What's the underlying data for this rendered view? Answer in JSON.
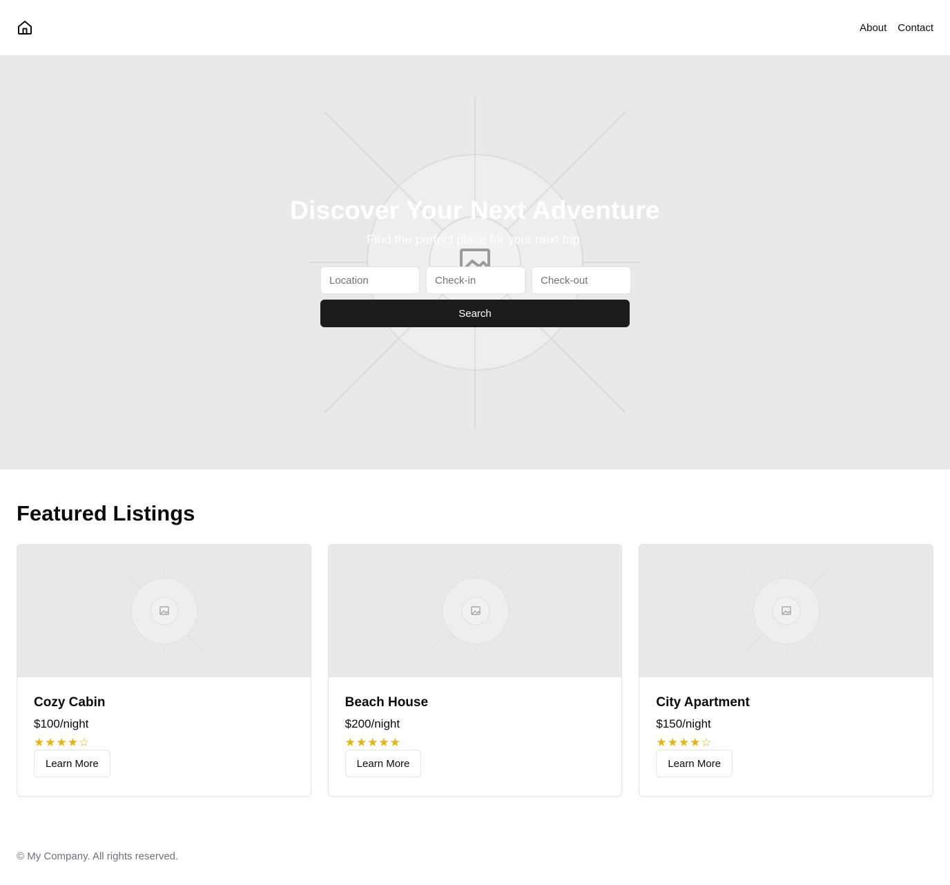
{
  "header": {
    "logo_icon": "home-icon",
    "nav": [
      "About",
      "Contact"
    ]
  },
  "hero": {
    "title": "Discover Your Next Adventure",
    "subtitle": "Find the perfect place for your next trip.",
    "background_icon": "image-placeholder-icon",
    "fields": {
      "location_placeholder": "Location",
      "checkin_placeholder": "Check-in",
      "checkout_placeholder": "Check-out"
    },
    "search_label": "Search"
  },
  "featured": {
    "title": "Featured Listings",
    "listings": [
      {
        "name": "Cozy Cabin",
        "price": "$100/night",
        "stars": "★★★★☆",
        "rating": 4,
        "button": "Learn More",
        "image_icon": "image-placeholder-icon"
      },
      {
        "name": "Beach House",
        "price": "$200/night",
        "stars": "★★★★★",
        "rating": 5,
        "button": "Learn More",
        "image_icon": "image-placeholder-icon"
      },
      {
        "name": "City Apartment",
        "price": "$150/night",
        "stars": "★★★★☆",
        "rating": 4,
        "button": "Learn More",
        "image_icon": "image-placeholder-icon"
      }
    ]
  },
  "footer": {
    "text": "© My Company. All rights reserved."
  },
  "colors": {
    "hero_bg": "#e9e9e9",
    "button_dark": "#1c1c1e",
    "star": "#eab308",
    "footer_text": "#6b7280"
  }
}
